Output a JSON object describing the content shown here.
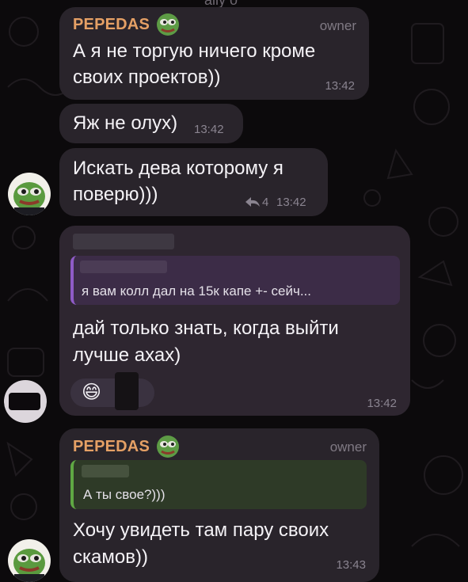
{
  "top_caption": "ally o",
  "messages": [
    {
      "sender": "PEPEDAS",
      "role": "owner",
      "text_lines": [
        "А я не торгую ничего кроме",
        "своих проектов))"
      ],
      "time": "13:42"
    },
    {
      "text": "Яж не олух)",
      "time": "13:42"
    },
    {
      "text_lines": [
        "Искать дева которому я",
        "поверю)))"
      ],
      "reply_count": "4",
      "time": "13:42"
    },
    {
      "quote_text": "я вам колл дал на 15к капе +- сейч...",
      "text_lines": [
        "дай только знать, когда выйти",
        "лучше ахах)"
      ],
      "reaction": "😄",
      "time": "13:42"
    },
    {
      "sender": "PEPEDAS",
      "role": "owner",
      "quote_text": "А ты свое?)))",
      "text_lines": [
        "Хочу увидеть там пару своих",
        "скамов))"
      ],
      "time": "13:43"
    }
  ],
  "colors": {
    "background": "#0c0a0c",
    "bubble": "#29242b",
    "sender": "#e5a065",
    "quote_purple": "#8f5bc7",
    "quote_green": "#5fa843"
  }
}
